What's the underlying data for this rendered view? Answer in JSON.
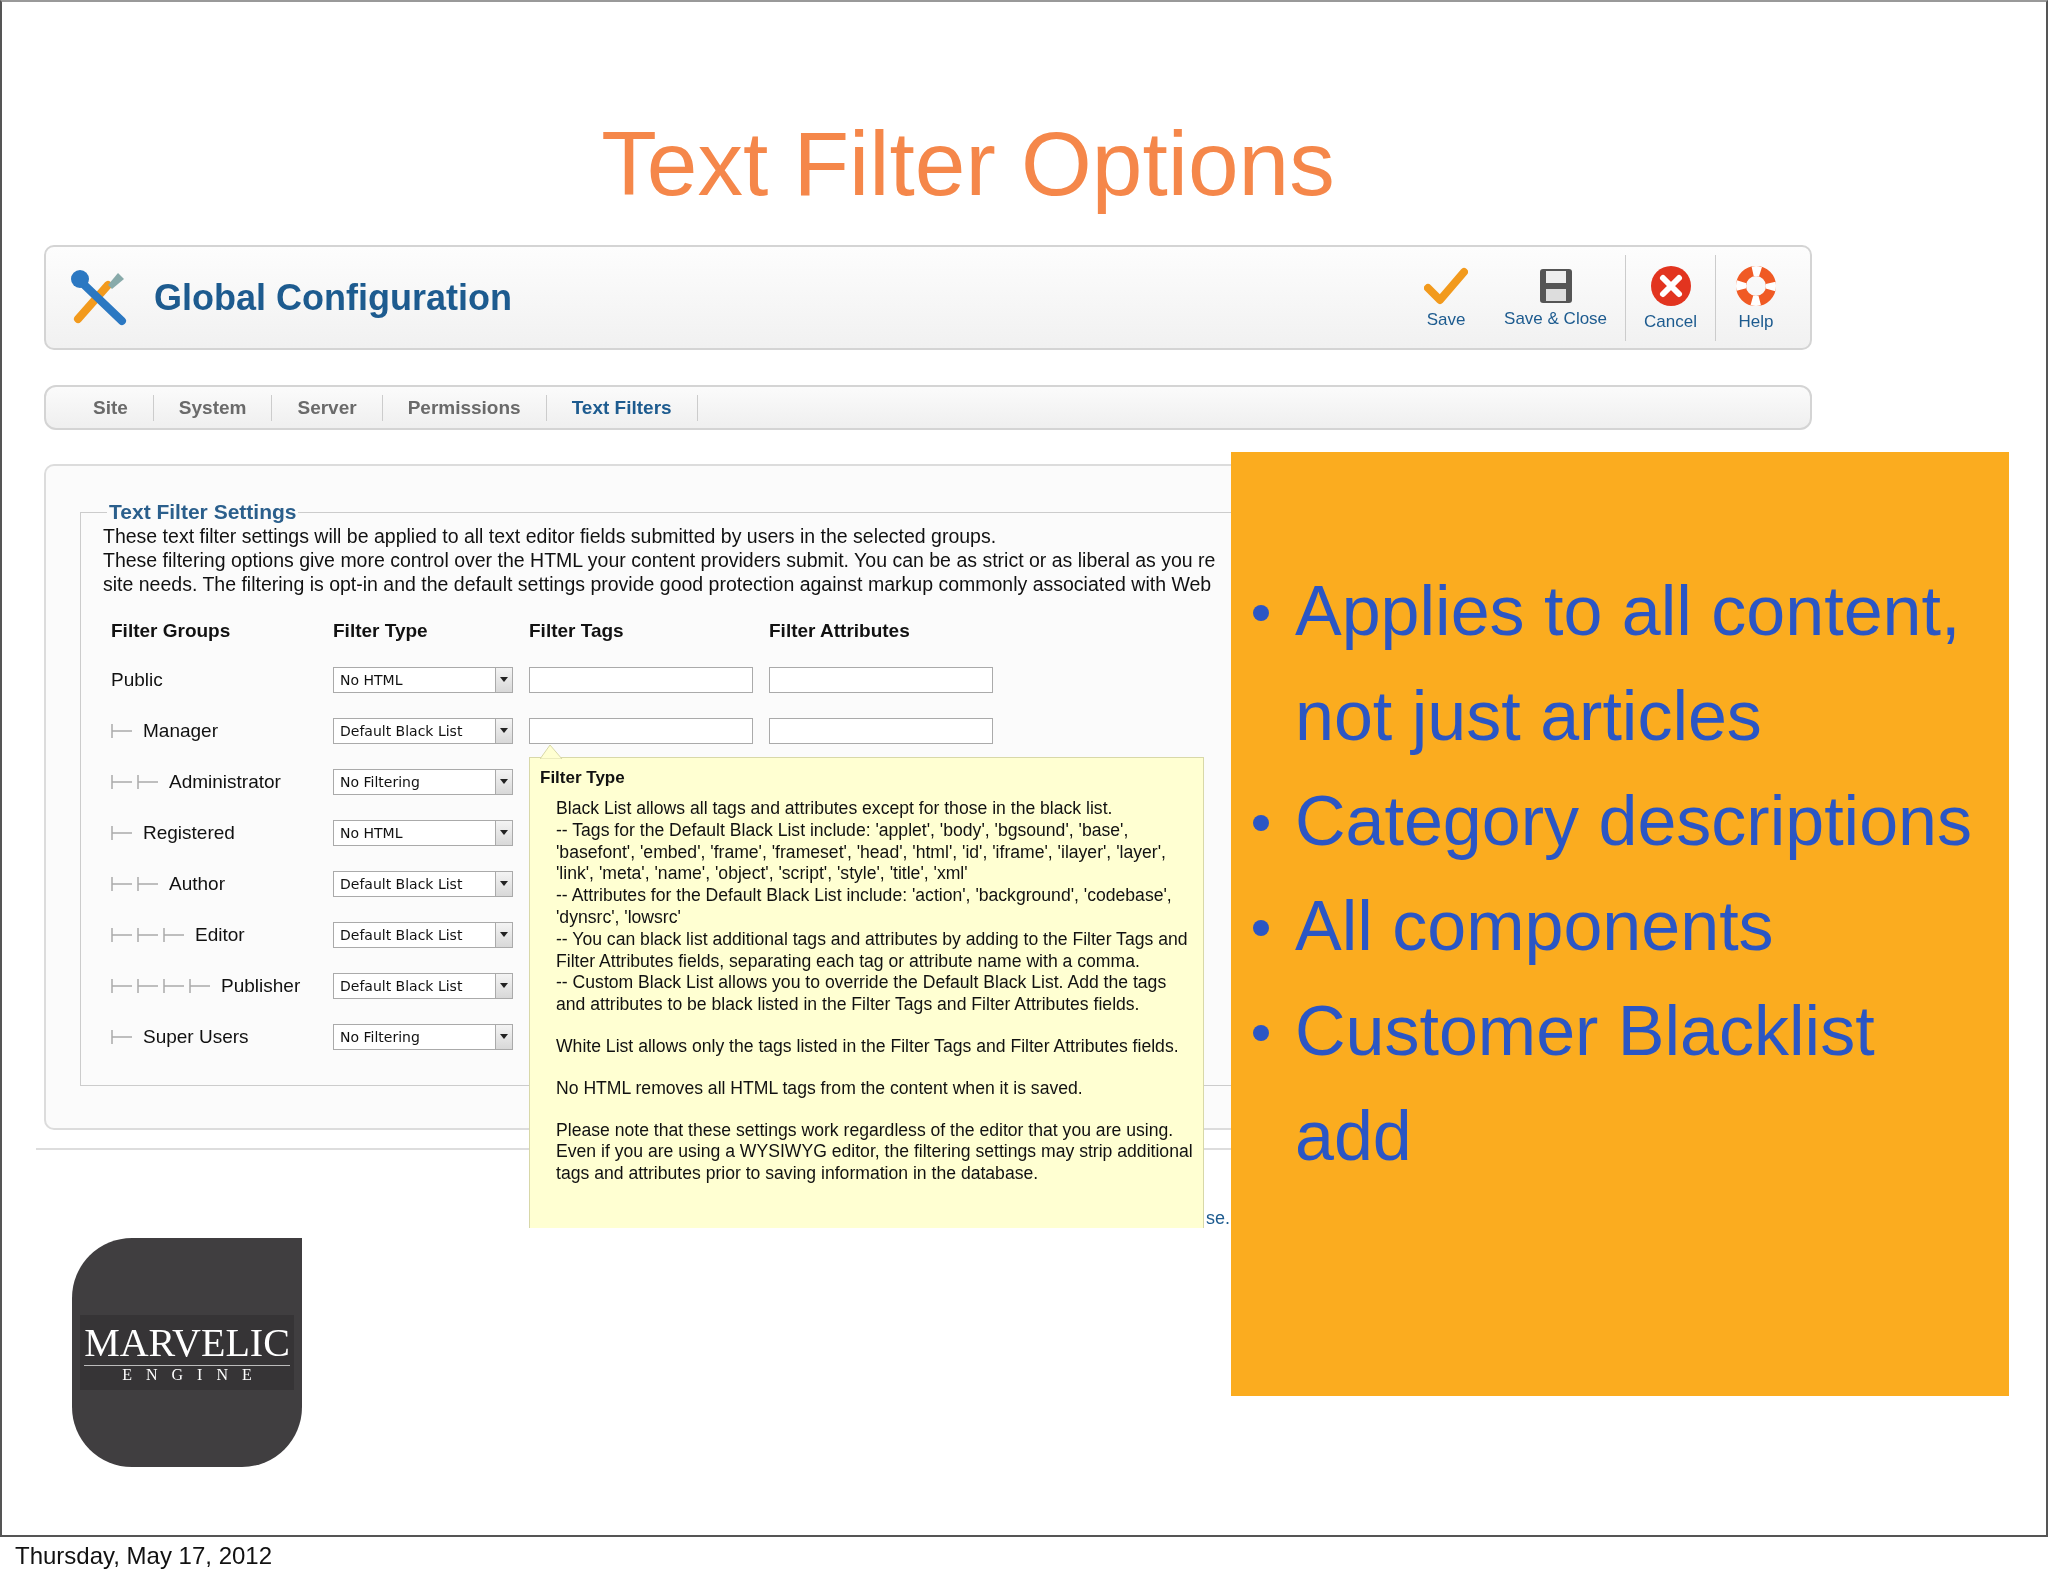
{
  "slide": {
    "title": "Text Filter Options",
    "footer_date": "Thursday, May 17, 2012"
  },
  "header": {
    "title": "Global Configuration",
    "toolbar": [
      {
        "label": "Save",
        "kind": "save"
      },
      {
        "label": "Save & Close",
        "kind": "save_close"
      },
      {
        "label": "Cancel",
        "kind": "cancel"
      },
      {
        "label": "Help",
        "kind": "help"
      }
    ]
  },
  "tabs": [
    {
      "label": "Site",
      "selected": false
    },
    {
      "label": "System",
      "selected": false
    },
    {
      "label": "Server",
      "selected": false
    },
    {
      "label": "Permissions",
      "selected": false
    },
    {
      "label": "Text Filters",
      "selected": true
    }
  ],
  "settings": {
    "legend": "Text Filter Settings",
    "intro_lines": [
      "These text filter settings will be applied to all text editor fields submitted by users in the selected groups.",
      "These filtering options give more control over the HTML your content providers submit. You can be as strict or as liberal as you re",
      "site needs. The filtering is opt-in and the default settings provide good protection against markup commonly associated with Web"
    ],
    "columns": [
      "Filter Groups",
      "Filter Type",
      "Filter Tags",
      "Filter Attributes"
    ],
    "groups": [
      {
        "name": "Public",
        "filter_type": "No HTML",
        "kind": "with_fields",
        "children": [
          {
            "name": "Manager",
            "filter_type": "Default Black List",
            "kind": "with_fields",
            "children": [
              {
                "name": "Administrator",
                "filter_type": "No Filtering"
              }
            ]
          },
          {
            "name": "Registered",
            "filter_type": "No HTML",
            "children": [
              {
                "name": "Author",
                "filter_type": "Default Black List",
                "children": [
                  {
                    "name": "Editor",
                    "filter_type": "Default Black List",
                    "children": [
                      {
                        "name": "Publisher",
                        "filter_type": "Default Black List"
                      }
                    ]
                  }
                ]
              }
            ]
          },
          {
            "name": "Super Users",
            "filter_type": "No Filtering"
          }
        ]
      }
    ],
    "trailing_text": "se."
  },
  "tooltip": {
    "title": "Filter Type",
    "blocks": [
      [
        "Black List allows all tags and attributes except for those in the black list.",
        "-- Tags for the Default Black List include: 'applet', 'body', 'bgsound', 'base', 'basefont', 'embed', 'frame', 'frameset', 'head', 'html', 'id', 'iframe', 'ilayer', 'layer', 'link', 'meta', 'name', 'object', 'script', 'style', 'title', 'xml'",
        "-- Attributes for the Default Black List include: 'action', 'background', 'codebase', 'dynsrc', 'lowsrc'",
        "-- You can black list additional tags and attributes by adding to the Filter Tags and Filter Attributes fields, separating each tag or attribute name with a comma.",
        "-- Custom Black List allows you to override the Default Black List. Add the tags and attributes to be black listed in the Filter Tags and Filter Attributes fields."
      ],
      [
        "White List allows only the tags listed in the Filter Tags and Filter Attributes fields."
      ],
      [
        "No HTML removes all HTML tags from the content when it is saved."
      ],
      [
        "Please note that these settings work regardless of the editor that you are using. Even if you are using a WYSIWYG editor, the filtering settings may strip additional tags and attributes prior to saving information in the database."
      ]
    ]
  },
  "callout": {
    "bullets": [
      "Applies to all content, not just articles",
      "Category descriptions",
      "All components",
      "Customer Blacklist add"
    ]
  },
  "logo": {
    "wordmark": "MARVELIC",
    "tagline": "ENGINE"
  }
}
